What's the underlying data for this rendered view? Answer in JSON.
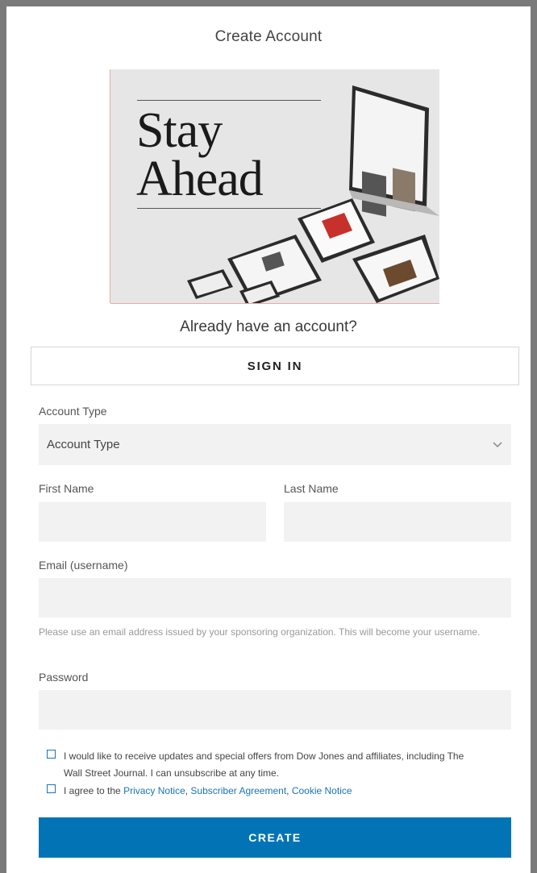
{
  "page": {
    "title": "Create Account"
  },
  "promo": {
    "line1": "Stay",
    "line2": "Ahead"
  },
  "signin": {
    "prompt": "Already have an account?",
    "button_label": "SIGN IN"
  },
  "form": {
    "account_type": {
      "label": "Account Type",
      "value": "Account Type"
    },
    "first_name": {
      "label": "First Name",
      "value": ""
    },
    "last_name": {
      "label": "Last Name",
      "value": ""
    },
    "email": {
      "label": "Email (username)",
      "value": "",
      "help": "Please use an email address issued by your sponsoring organization. This will become your username."
    },
    "password": {
      "label": "Password",
      "value": ""
    },
    "offers": {
      "text": "I would like to receive updates and special offers from Dow Jones and affiliates, including The Wall Street Journal. I can unsubscribe at any time."
    },
    "agree": {
      "prefix": "I agree to the ",
      "privacy": "Privacy Notice",
      "sep1": ", ",
      "subscriber": "Subscriber Agreement",
      "sep2": ", ",
      "cookie": "Cookie Notice"
    },
    "submit_label": "CREATE"
  },
  "colors": {
    "accent": "#0274b6",
    "link": "#1a73b8",
    "field_bg": "#f2f2f2",
    "frame": "#7a7a7a"
  },
  "icons": {
    "select": "chevron-down-icon"
  }
}
